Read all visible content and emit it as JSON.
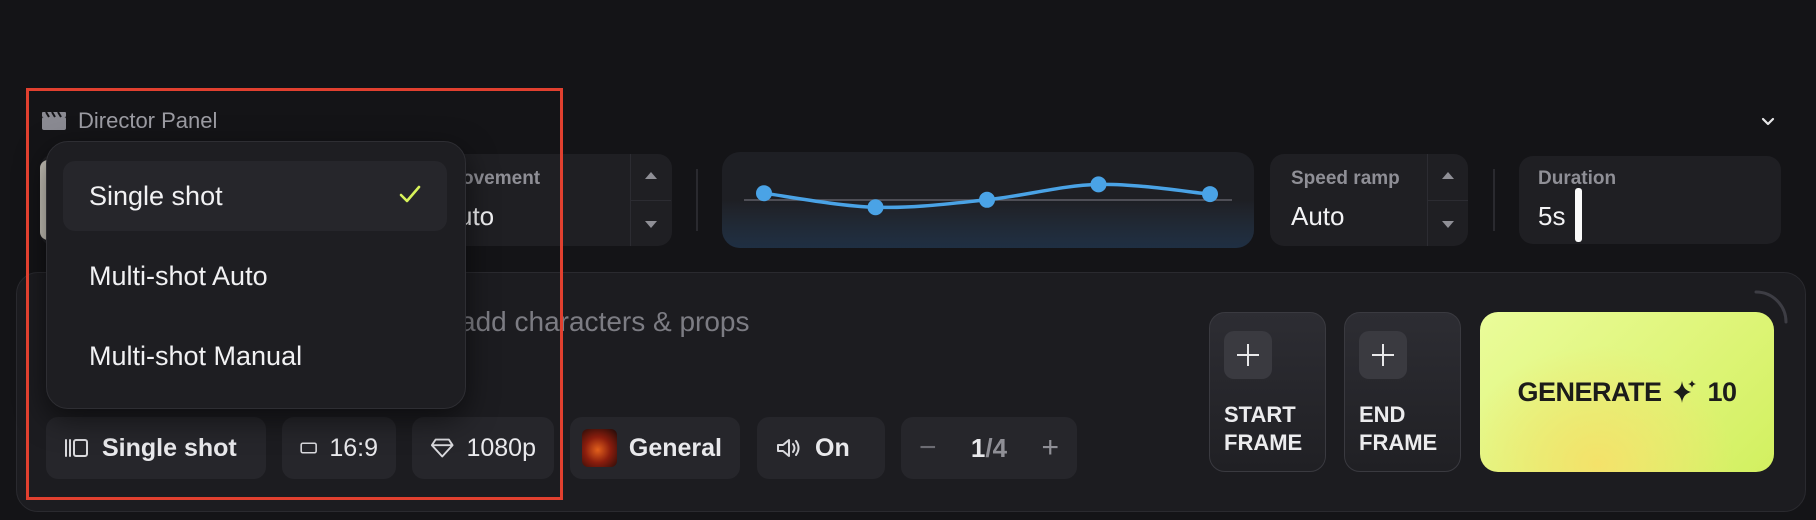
{
  "header": {
    "title": "Director Panel",
    "clapper_icon": "clapperboard-icon",
    "collapse_icon": "chevron-down-icon"
  },
  "camera": {
    "label": "Camera movement",
    "label_visible": "ovement",
    "value": "Auto",
    "value_visible": "uto"
  },
  "curve": {
    "points": [
      0.3,
      0.62,
      0.45,
      0.1,
      0.32
    ]
  },
  "speed_ramp": {
    "label": "Speed ramp",
    "value": "Auto"
  },
  "duration": {
    "label": "Duration",
    "value": "5s"
  },
  "prompt": {
    "placeholder": "add characters & props"
  },
  "toolbar": {
    "shot_mode": "Single shot",
    "aspect": "16:9",
    "resolution": "1080p",
    "style": "General",
    "audio": "On",
    "count_current": "1",
    "count_total": "/4"
  },
  "frames": {
    "start": "START\nFRAME",
    "end": "END\nFRAME"
  },
  "generate": {
    "label": "GENERATE",
    "cost": "10",
    "icon": "sparkle-icon"
  },
  "dropdown": {
    "items": [
      {
        "label": "Single shot",
        "selected": true
      },
      {
        "label": "Multi-shot Auto",
        "selected": false
      },
      {
        "label": "Multi-shot Manual",
        "selected": false
      }
    ]
  },
  "colors": {
    "accent": "#dff57a",
    "curve": "#4aa3e6",
    "highlight": "#e1402f",
    "check": "#d7f25a"
  }
}
